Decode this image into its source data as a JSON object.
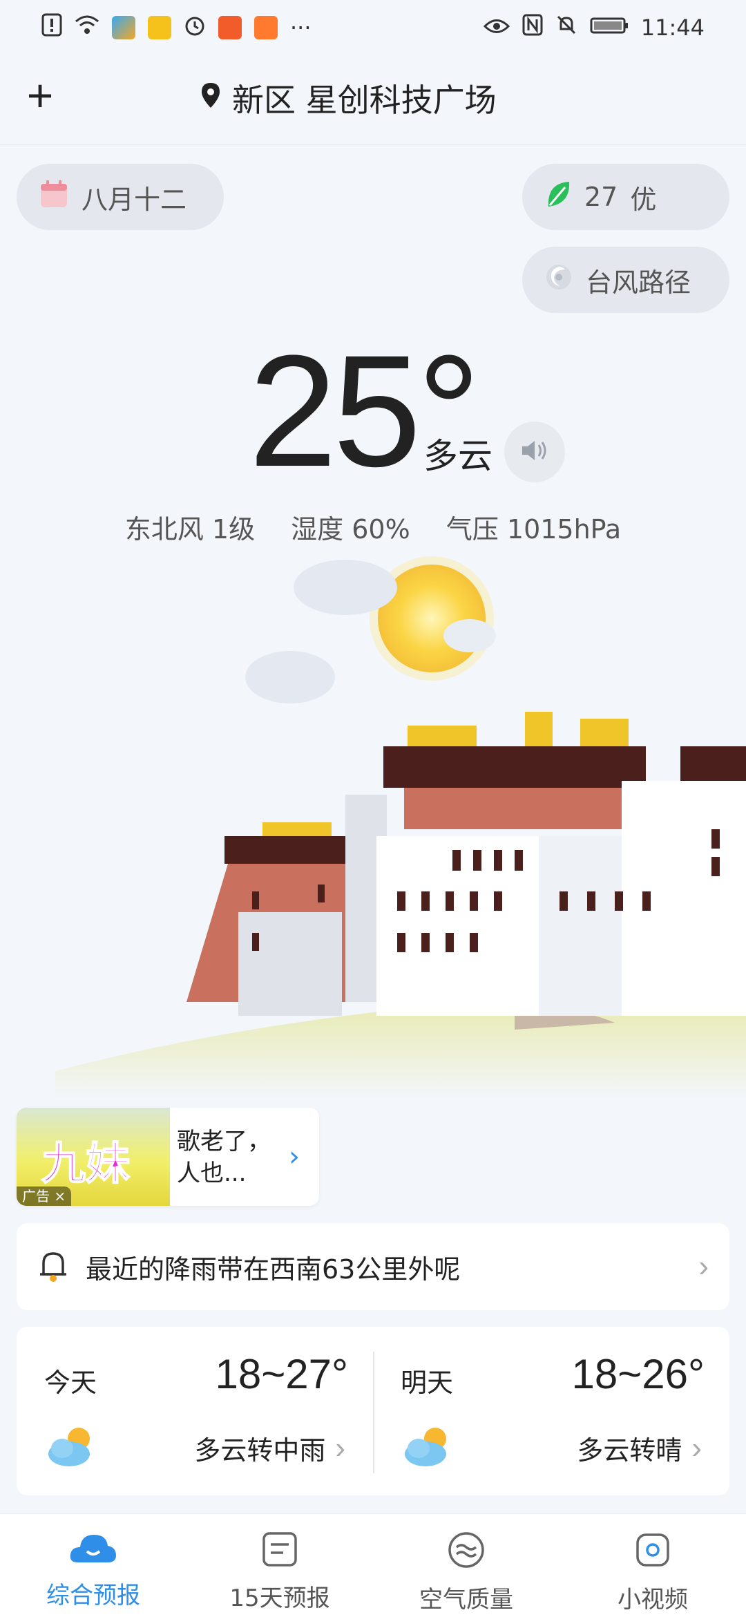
{
  "status_bar": {
    "time": "11:44",
    "more": "···"
  },
  "header": {
    "add_label": "+",
    "location": "新区 星创科技广场"
  },
  "lunar_date": "八月十二",
  "aqi": {
    "value": "27",
    "level": "优"
  },
  "typhoon_label": "台风路径",
  "current": {
    "temperature": "25°",
    "condition": "多云",
    "wind": "东北风 1级",
    "humidity": "湿度 60%",
    "pressure": "气压 1015hPa"
  },
  "ad": {
    "image_text": "九妹",
    "tag": "广告 ×",
    "text": "歌老了，人也..."
  },
  "rain_alert": "最近的降雨带在西南63公里外呢",
  "forecast": [
    {
      "day": "今天",
      "range": "18~27°",
      "condition": "多云转中雨"
    },
    {
      "day": "明天",
      "range": "18~26°",
      "condition": "多云转晴"
    }
  ],
  "tabs": [
    {
      "label": "综合预报",
      "icon": "cloud-smile-icon",
      "active": true
    },
    {
      "label": "15天预报",
      "icon": "calendar-list-icon",
      "active": false
    },
    {
      "label": "空气质量",
      "icon": "air-wave-icon",
      "active": false
    },
    {
      "label": "小视频",
      "icon": "video-icon",
      "active": false
    }
  ],
  "colors": {
    "accent": "#2f8ee8",
    "background": "#f3f6fb",
    "aqi_leaf": "#2bbf5b"
  }
}
